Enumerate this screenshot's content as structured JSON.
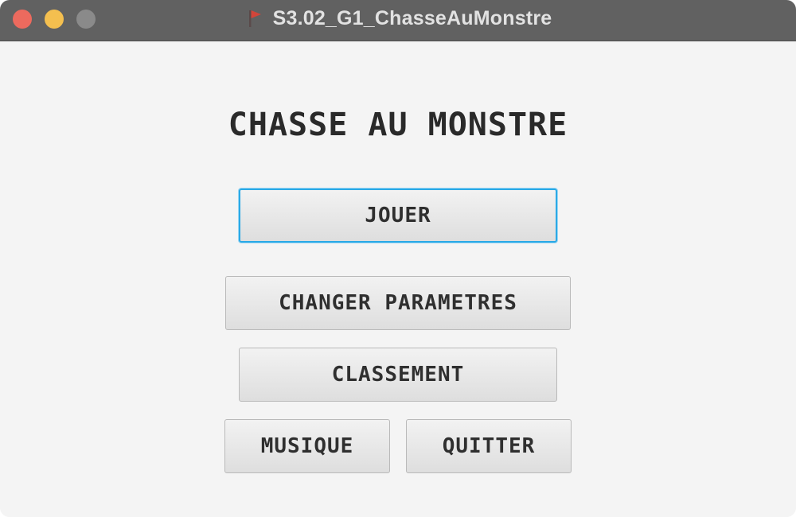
{
  "window": {
    "title": "S3.02_G1_ChasseAuMonstre",
    "title_icon": "red-flag-icon",
    "controls": {
      "close_color": "#ec6a5e",
      "minimize_color": "#f4bf4f",
      "zoom_color": "#8a8a8a"
    }
  },
  "menu": {
    "heading": "CHASSE AU MONSTRE",
    "buttons": {
      "play": "JOUER",
      "settings": "CHANGER PARAMETRES",
      "ranking": "CLASSEMENT",
      "music": "MUSIQUE",
      "quit": "QUITTER"
    },
    "focused_button": "play",
    "focus_color": "#2aa9e6"
  }
}
